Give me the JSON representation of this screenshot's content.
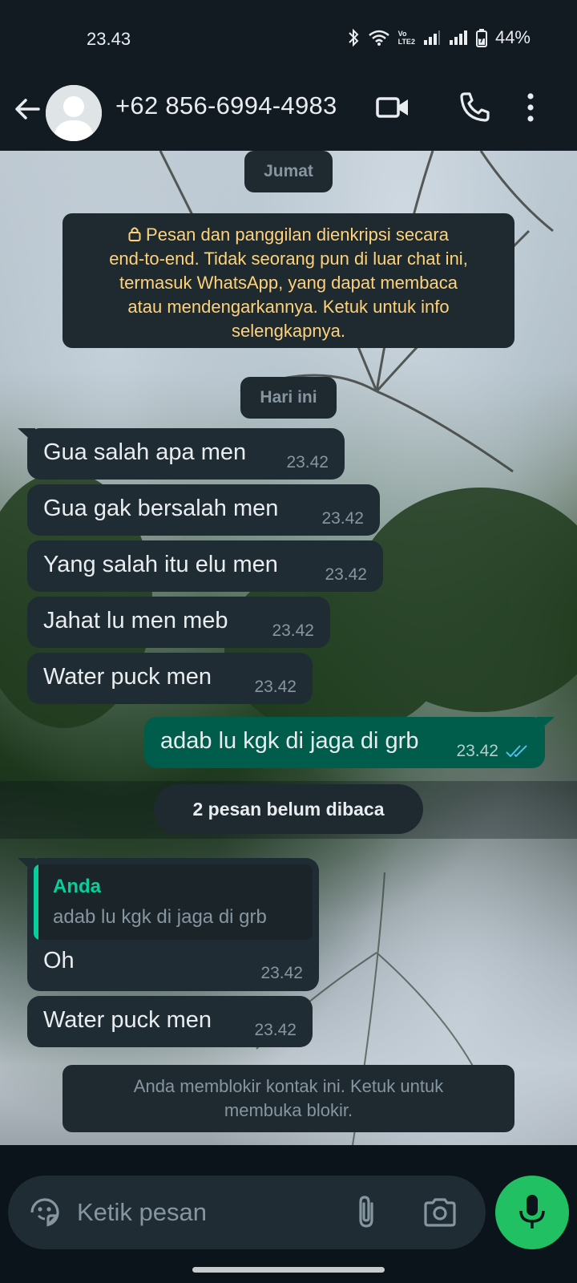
{
  "status_bar": {
    "time": "23.43",
    "battery": "44%",
    "network_label_top": "Vo",
    "network_label_bottom": "LTE2"
  },
  "header": {
    "contact": "+62 856-6994-4983",
    "icons": [
      "back-arrow-icon",
      "avatar",
      "video-call-icon",
      "voice-call-icon",
      "more-options-icon"
    ]
  },
  "chat": {
    "date_pill_1": "Jumat",
    "encryption_notice": [
      "Pesan dan panggilan dienkripsi secara",
      "end-to-end. Tidak seorang pun di luar chat ini,",
      "termasuk WhatsApp, yang dapat membaca",
      "atau mendengarkannya. Ketuk untuk info",
      "selengkapnya."
    ],
    "date_pill_2": "Hari ini",
    "messages": [
      {
        "dir": "in",
        "text": "Gua salah apa men",
        "time": "23.42"
      },
      {
        "dir": "in",
        "text": "Gua gak bersalah men",
        "time": "23.42"
      },
      {
        "dir": "in",
        "text": "Yang salah itu elu men",
        "time": "23.42"
      },
      {
        "dir": "in",
        "text": "Jahat lu men meb",
        "time": "23.42"
      },
      {
        "dir": "in",
        "text": "Water puck men",
        "time": "23.42"
      },
      {
        "dir": "out",
        "text": "adab lu kgk di jaga di grb",
        "time": "23.42",
        "status": "read"
      }
    ],
    "unread_banner": "2 pesan belum dibaca",
    "reply_message": {
      "quote_author": "Anda",
      "quote_text": "adab lu kgk di jaga di grb",
      "text": "Oh",
      "time": "23.42"
    },
    "last_message": {
      "text": "Water puck men",
      "time": "23.42"
    },
    "blocked_notice": [
      "Anda memblokir kontak ini. Ketuk untuk",
      "membuka blokir."
    ]
  },
  "input": {
    "placeholder": "Ketik pesan",
    "icons": [
      "sticker-icon",
      "attach-icon",
      "camera-icon",
      "mic-icon"
    ]
  },
  "colors": {
    "bar_bg": "#121b22",
    "bubble_in": "#1f2c34",
    "bubble_out": "#005c4b",
    "accent_green": "#21c063",
    "notice_yellow": "#ffd279",
    "quote_green": "#06cf9c",
    "read_tick": "#53bdeb"
  }
}
